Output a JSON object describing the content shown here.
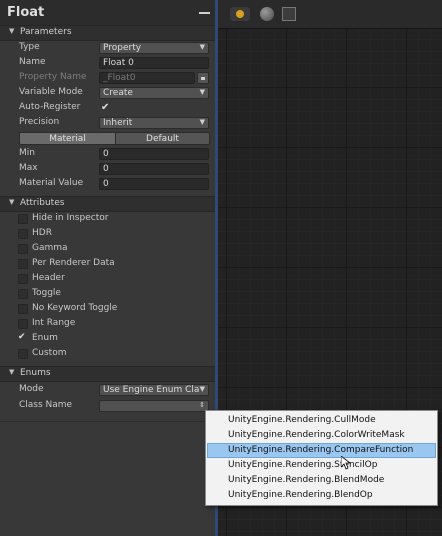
{
  "panel": {
    "title": "Float",
    "sections": {
      "parameters": "Parameters",
      "attributes": "Attributes",
      "enums": "Enums"
    }
  },
  "parameters": {
    "type": {
      "label": "Type",
      "value": "Property"
    },
    "name": {
      "label": "Name",
      "value": "Float 0"
    },
    "property_name": {
      "label": "Property Name",
      "value": "_Float0"
    },
    "variable_mode": {
      "label": "Variable Mode",
      "value": "Create"
    },
    "auto_register": {
      "label": "Auto-Register",
      "checked": true
    },
    "precision": {
      "label": "Precision",
      "value": "Inherit"
    },
    "toggle": {
      "material": "Material",
      "default": "Default",
      "active": "Material"
    },
    "min": {
      "label": "Min",
      "value": "0"
    },
    "max": {
      "label": "Max",
      "value": "0"
    },
    "material_value": {
      "label": "Material Value",
      "value": "0"
    }
  },
  "attributes": [
    {
      "label": "Hide in Inspector",
      "checked": false
    },
    {
      "label": "HDR",
      "checked": false
    },
    {
      "label": "Gamma",
      "checked": false
    },
    {
      "label": "Per Renderer Data",
      "checked": false
    },
    {
      "label": "Header",
      "checked": false
    },
    {
      "label": "Toggle",
      "checked": false
    },
    {
      "label": "No Keyword Toggle",
      "checked": false
    },
    {
      "label": "Int Range",
      "checked": false
    },
    {
      "label": "Enum",
      "checked": true
    },
    {
      "label": "Custom",
      "checked": false
    }
  ],
  "enums": {
    "mode": {
      "label": "Mode",
      "value": "Use Engine Enum Clas"
    },
    "class_name": {
      "label": "Class Name",
      "value": ""
    }
  },
  "popup": {
    "options": [
      "UnityEngine.Rendering.CullMode",
      "UnityEngine.Rendering.ColorWriteMask",
      "UnityEngine.Rendering.CompareFunction",
      "UnityEngine.Rendering.StencilOp",
      "UnityEngine.Rendering.BlendMode",
      "UnityEngine.Rendering.BlendOp"
    ],
    "selected_index": 2
  },
  "icons": {
    "title_menu": "menu-icon",
    "toolbar": [
      "light-icon",
      "sphere-preview-icon",
      "texture-icon"
    ]
  },
  "colors": {
    "panel_bg": "#383838",
    "graph_bg": "#222222",
    "graph_edge": "#2d4a78",
    "popup_selection": "#99c7ef"
  }
}
